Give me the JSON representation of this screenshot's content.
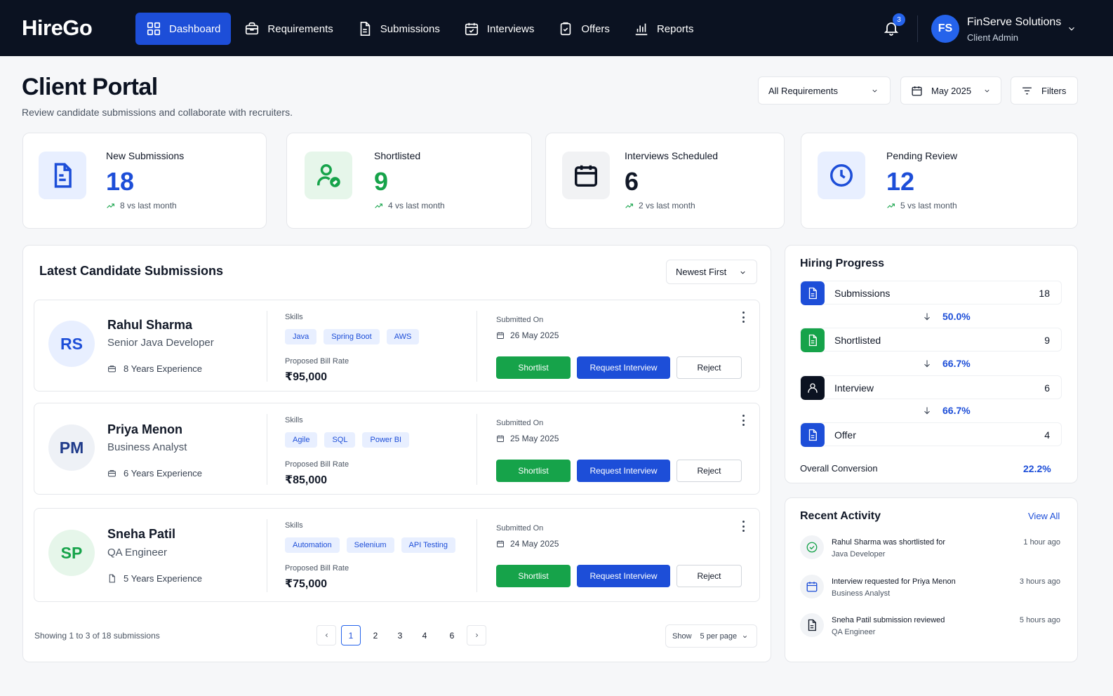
{
  "app": {
    "name": "HireGo"
  },
  "nav": {
    "items": [
      {
        "label": "Dashboard",
        "icon": "grid-icon",
        "active": true
      },
      {
        "label": "Requirements",
        "icon": "briefcase-icon"
      },
      {
        "label": "Submissions",
        "icon": "document-icon"
      },
      {
        "label": "Interviews",
        "icon": "calendar-check-icon"
      },
      {
        "label": "Offers",
        "icon": "clipboard-check-icon"
      },
      {
        "label": "Reports",
        "icon": "bar-chart-icon"
      }
    ],
    "notifications_count": "3"
  },
  "user": {
    "initials": "FS",
    "name": "FinServe Solutions",
    "role": "Client Admin"
  },
  "header": {
    "title": "Client Portal",
    "subtitle": "Review candidate submissions and collaborate with recruiters.",
    "requirement_filter": "All Requirements",
    "month_filter": "May 2025",
    "filters_label": "Filters"
  },
  "stats": [
    {
      "label": "New Submissions",
      "value": "18",
      "trend": "8 vs last month",
      "color": "#1d4ed8"
    },
    {
      "label": "Shortlisted",
      "value": "9",
      "trend": "4 vs last month",
      "color": "#16a34a"
    },
    {
      "label": "Interviews Scheduled",
      "value": "6",
      "trend": "2 vs last month",
      "color": "#0b1221"
    },
    {
      "label": "Pending Review",
      "value": "12",
      "trend": "5 vs last month",
      "color": "#1d4ed8"
    }
  ],
  "submissions": {
    "title": "Latest Candidate Submissions",
    "sort": "Newest First",
    "skills_label": "Skills",
    "rate_label": "Proposed Bill Rate",
    "submitted_label": "Submitted On",
    "actions": {
      "shortlist": "Shortlist",
      "request_interview": "Request Interview",
      "reject": "Reject"
    },
    "candidates": [
      {
        "initials": "RS",
        "name": "Rahul Sharma",
        "role": "Senior Java Developer",
        "experience": "8 Years Experience",
        "skills": [
          "Java",
          "Spring Boot",
          "AWS"
        ],
        "rate": "₹95,000",
        "date": "26 May 2025"
      },
      {
        "initials": "PM",
        "name": "Priya Menon",
        "role": "Business Analyst",
        "experience": "6 Years Experience",
        "skills": [
          "Agile",
          "SQL",
          "Power BI"
        ],
        "rate": "₹85,000",
        "date": "25 May 2025"
      },
      {
        "initials": "SP",
        "name": "Sneha Patil",
        "role": "QA Engineer",
        "experience": "5 Years Experience",
        "skills": [
          "Automation",
          "Selenium",
          "API Testing"
        ],
        "rate": "₹75,000",
        "date": "24 May 2025"
      }
    ],
    "pagination": {
      "info": "Showing 1 to 3 of 18 submissions",
      "pages": [
        "1",
        "2",
        "3",
        "4",
        "6"
      ],
      "current": "1",
      "show_label": "Show",
      "per_page": "5 per page"
    }
  },
  "hiring_progress": {
    "title": "Hiring Progress",
    "stages": [
      {
        "label": "Submissions",
        "count": "18",
        "color": "#1d4ed8"
      },
      {
        "label": "Shortlisted",
        "count": "9",
        "color": "#16a34a"
      },
      {
        "label": "Interview",
        "count": "6",
        "color": "#0b1221"
      },
      {
        "label": "Offer",
        "count": "4",
        "color": "#1d4ed8"
      }
    ],
    "conversions": [
      "50.0%",
      "66.7%",
      "66.7%"
    ],
    "overall_label": "Overall Conversion",
    "overall_value": "22.2%"
  },
  "activity": {
    "title": "Recent Activity",
    "view_all": "View All",
    "items": [
      {
        "icon": "check-circle-icon",
        "title": "Rahul Sharma was shortlisted for",
        "sub": "Java Developer",
        "time": "1 hour ago"
      },
      {
        "icon": "calendar-icon",
        "title": "Interview requested for Priya Menon",
        "sub": "Business Analyst",
        "time": "3 hours ago"
      },
      {
        "icon": "document-icon",
        "title": "Sneha Patil submission reviewed",
        "sub": "QA Engineer",
        "time": "5 hours ago"
      }
    ]
  }
}
